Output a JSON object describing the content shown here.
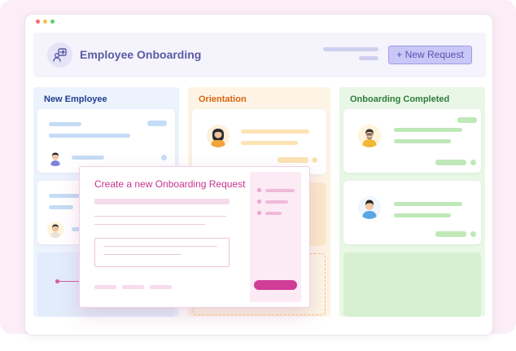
{
  "app": {
    "title": "Employee Onboarding",
    "new_request_label": "+ New Request"
  },
  "columns": [
    {
      "title": "New Employee",
      "color": "#1f3f8f",
      "background": "#edf3fd"
    },
    {
      "title": "Orientation",
      "color": "#d9640f",
      "background": "#fdf4e6"
    },
    {
      "title": "Onboarding Completed",
      "color": "#2e7c3c",
      "background": "#e9f7e6"
    }
  ],
  "modal": {
    "title": "Create a new Onboarding Request"
  },
  "icons": {
    "header": "user-swap-icon"
  },
  "colors": {
    "accent_purple": "#5b5aa5",
    "accent_pink": "#c8338f",
    "submit_pink": "#cf3d97"
  }
}
